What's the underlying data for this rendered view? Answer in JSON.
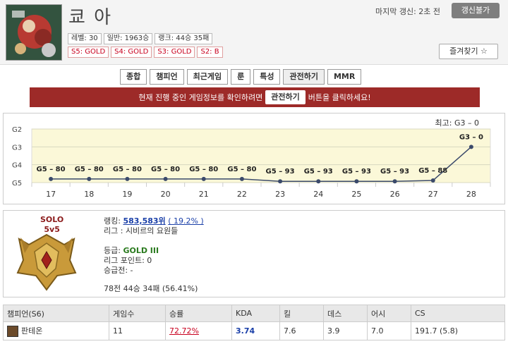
{
  "profile": {
    "name": "쿄 아",
    "level": "레벨: 30",
    "normal": "일반: 1963승",
    "ranked": "랭크: 44승 35패",
    "seasons": [
      "S5: GOLD",
      "S4: GOLD",
      "S3: GOLD",
      "S2: B"
    ],
    "last_update": "마지막 갱신: 2초 전",
    "update_button": "갱신불가",
    "favorite_button": "즐겨찾기 ☆"
  },
  "tabs": [
    "종합",
    "챔피언",
    "최근게임",
    "룬",
    "특성",
    "관전하기",
    "MMR"
  ],
  "active_tab": "관전하기",
  "banner": {
    "before": "현재 진행 중인 게임정보를 확인하려면",
    "button": "관전하기",
    "after": "버튼을 클릭하세요!"
  },
  "colors": {
    "banner": "#9d2a28",
    "chart_band": "#fbf8d8",
    "line": "#3b4a6b"
  },
  "chart_data": {
    "type": "line",
    "title": "최고: G3 – 0",
    "x": [
      "17",
      "18",
      "19",
      "20",
      "21",
      "22",
      "23",
      "24",
      "25",
      "26",
      "27",
      "28"
    ],
    "y_ticks": [
      "G2",
      "G3",
      "G4",
      "G5"
    ],
    "values": [
      4.8,
      4.8,
      4.8,
      4.8,
      4.8,
      4.8,
      4.93,
      4.93,
      4.93,
      4.93,
      4.88,
      3.0
    ],
    "point_labels": [
      "G5 – 80",
      "G5 – 80",
      "G5 – 80",
      "G5 – 80",
      "G5 – 80",
      "G5 – 80",
      "G5 – 93",
      "G5 – 93",
      "G5 – 93",
      "G5 – 93",
      "G5 – 88",
      "G3 – 0"
    ],
    "ylim": [
      2,
      5
    ],
    "grid": true
  },
  "solo": {
    "queue": "SOLO",
    "format": "5v5",
    "ranking_label": "랭킹: ",
    "ranking_value": "583,583위",
    "ranking_pct": "( 19.2% )",
    "league": "리그 : 시비르의 요원들",
    "tier_label": "등급: ",
    "tier_value": "GOLD III",
    "league_points": "리그 포인트: 0",
    "promo": "승급전: -",
    "record": "78전 44승 34패 (56.41%)"
  },
  "table": {
    "headers": [
      "챔피언(S6)",
      "게임수",
      "승률",
      "KDA",
      "킬",
      "데스",
      "어시",
      "CS"
    ],
    "rows": [
      {
        "champion": "판테온",
        "games": "11",
        "winrate": "72.72%",
        "kda": "3.74",
        "kills": "7.6",
        "deaths": "3.9",
        "assists": "7.0",
        "cs": "191.7 (5.8)"
      }
    ]
  }
}
